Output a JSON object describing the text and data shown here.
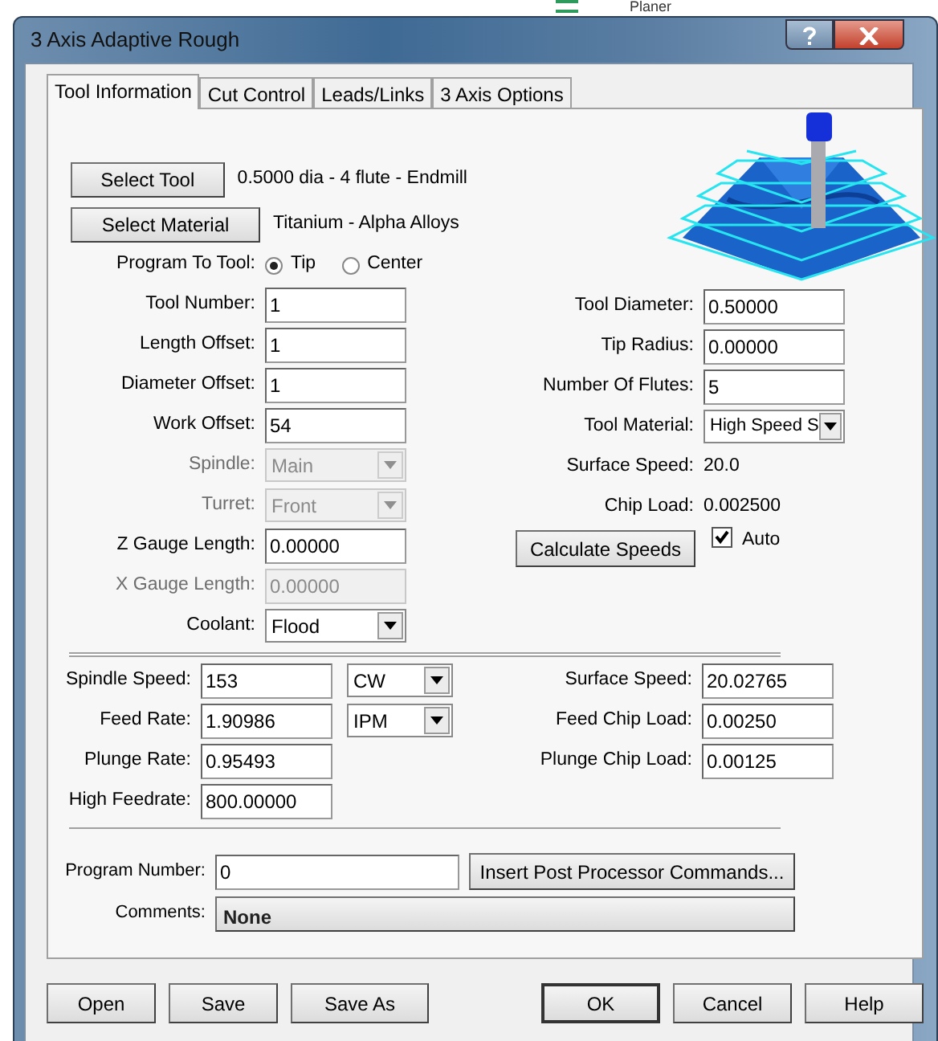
{
  "background": {
    "item": "Planer"
  },
  "window": {
    "title": "3 Axis Adaptive Rough"
  },
  "tabs": [
    {
      "label": "Tool Information",
      "selected": true
    },
    {
      "label": "Cut Control",
      "selected": false
    },
    {
      "label": "Leads/Links",
      "selected": false
    },
    {
      "label": "3 Axis Options",
      "selected": false
    }
  ],
  "tool": {
    "select_tool_button": "Select Tool",
    "tool_description": "0.5000 dia - 4 flute - Endmill",
    "select_material_button": "Select Material",
    "material_description": "Titanium - Alpha Alloys"
  },
  "program_to_tool": {
    "label": "Program To Tool:",
    "options": [
      {
        "label": "Tip",
        "selected": true
      },
      {
        "label": "Center",
        "selected": false
      }
    ]
  },
  "left_fields": [
    {
      "label": "Tool Number:",
      "value": "1",
      "kind": "text",
      "disabled": false
    },
    {
      "label": "Length Offset:",
      "value": "1",
      "kind": "text",
      "disabled": false
    },
    {
      "label": "Diameter Offset:",
      "value": "1",
      "kind": "text",
      "disabled": false
    },
    {
      "label": "Work Offset:",
      "value": "54",
      "kind": "text",
      "disabled": false
    },
    {
      "label": "Spindle:",
      "value": "Main",
      "kind": "select",
      "disabled": true
    },
    {
      "label": "Turret:",
      "value": "Front",
      "kind": "select",
      "disabled": true
    },
    {
      "label": "Z Gauge Length:",
      "value": "0.00000",
      "kind": "text",
      "disabled": false
    },
    {
      "label": "X Gauge Length:",
      "value": "0.00000",
      "kind": "text",
      "disabled": true
    },
    {
      "label": "Coolant:",
      "value": "Flood",
      "kind": "select",
      "disabled": false
    }
  ],
  "right_fields": [
    {
      "label": "Tool Diameter:",
      "value": "0.50000",
      "kind": "text"
    },
    {
      "label": "Tip Radius:",
      "value": "0.00000",
      "kind": "text"
    },
    {
      "label": "Number Of Flutes:",
      "value": "5",
      "kind": "text"
    },
    {
      "label": "Tool Material:",
      "value": "High Speed S",
      "kind": "select"
    },
    {
      "label": "Surface Speed:",
      "value": "20.0",
      "kind": "readout"
    },
    {
      "label": "Chip Load:",
      "value": "0.002500",
      "kind": "readout"
    }
  ],
  "calculate_button": "Calculate Speeds",
  "auto": {
    "label": "Auto",
    "checked": true
  },
  "feed_fields_left": [
    {
      "label": "Spindle Speed:",
      "value": "153",
      "unit": "CW"
    },
    {
      "label": "Feed Rate:",
      "value": "1.90986",
      "unit": "IPM"
    },
    {
      "label": "Plunge Rate:",
      "value": "0.95493"
    },
    {
      "label": "High Feedrate:",
      "value": "800.00000"
    }
  ],
  "feed_fields_right": [
    {
      "label": "Surface Speed:",
      "value": "20.02765"
    },
    {
      "label": "Feed Chip Load:",
      "value": "0.00250"
    },
    {
      "label": "Plunge Chip Load:",
      "value": "0.00125"
    }
  ],
  "program_number": {
    "label": "Program Number:",
    "value": "0"
  },
  "post_button": "Insert Post Processor Commands...",
  "comments": {
    "label": "Comments:",
    "value": "None"
  },
  "buttons_left": [
    {
      "label": "Open",
      "default": false
    },
    {
      "label": "Save",
      "default": false
    },
    {
      "label": "Save As",
      "default": false
    }
  ],
  "buttons_right": [
    {
      "label": "OK",
      "default": true
    },
    {
      "label": "Cancel",
      "default": false
    },
    {
      "label": "Help",
      "default": false
    }
  ]
}
